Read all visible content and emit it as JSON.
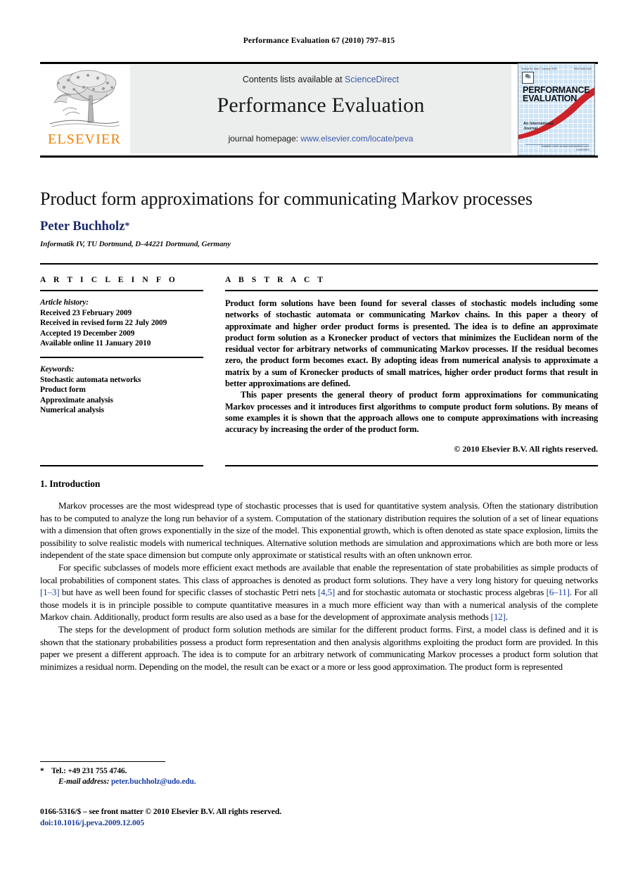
{
  "running_head": "Performance Evaluation 67 (2010) 797–815",
  "journal_header": {
    "contents_prefix": "Contents lists available at ",
    "contents_link": "ScienceDirect",
    "journal_name": "Performance Evaluation",
    "homepage_prefix": "journal homepage: ",
    "homepage_link": "www.elsevier.com/locate/peva",
    "publisher_wordmark": "ELSEVIER",
    "link_color": "#3a5ba8",
    "panel_color": "#eceded",
    "elsevier_orange": "#f08000"
  },
  "cover": {
    "top_left": "Volume 64, Issue 1  January 2009",
    "top_right": "ISSN 0166-5316",
    "title_line1": "PERFORMANCE",
    "title_line2": "EVALUATION",
    "subtitle_line1": "An International",
    "subtitle_line2": "Journal",
    "footer": "Available online at www.sciencedirect.com",
    "publisher": "ELSEVIER",
    "grid_color": "#cfe4f5",
    "swoosh_color": "#cc2229"
  },
  "article": {
    "title": "Product form approximations for communicating Markov processes",
    "author": "Peter Buchholz",
    "author_marker": "*",
    "author_color": "#1c2a6b",
    "affiliation": "Informatik IV, TU Dortmund, D–44221 Dortmund, Germany"
  },
  "article_info": {
    "tag": "A R T I C L E   I N F O",
    "history_head": "Article history:",
    "history": [
      "Received 23 February 2009",
      "Received in revised form 22 July 2009",
      "Accepted 19 December 2009",
      "Available online 11 January 2010"
    ],
    "keywords_head": "Keywords:",
    "keywords": [
      "Stochastic automata networks",
      "Product form",
      "Approximate analysis",
      "Numerical analysis"
    ]
  },
  "abstract": {
    "tag": "A B S T R A C T",
    "paragraph1": "Product form solutions have been found for several classes of stochastic models including some networks of stochastic automata or communicating Markov chains. In this paper a theory of approximate and higher order product forms is presented. The idea is to define an approximate product form solution as a Kronecker product of vectors that minimizes the Euclidean norm of the residual vector for arbitrary networks of communicating Markov processes. If the residual becomes zero, the product form becomes exact. By adopting ideas from numerical analysis to approximate a matrix by a sum of Kronecker products of small matrices, higher order product forms that result in better approximations are defined.",
    "paragraph2": "This paper presents the general theory of product form approximations for communicating Markov processes and it introduces first algorithms to compute product form solutions. By means of some examples it is shown that the approach allows one to compute approximations with increasing accuracy by increasing the order of the product form.",
    "copyright": "© 2010 Elsevier B.V. All rights reserved."
  },
  "body": {
    "section_heading": "1. Introduction",
    "para1": "Markov processes are the most widespread type of stochastic processes that is used for quantitative system analysis. Often the stationary distribution has to be computed to analyze the long run behavior of a system. Computation of the stationary distribution requires the solution of a set of linear equations with a dimension that often grows exponentially in the size of the model. This exponential growth, which is often denoted as state space explosion, limits the possibility to solve realistic models with numerical techniques. Alternative solution methods are simulation and approximations which are both more or less independent of the state space dimension but compute only approximate or statistical results with an often unknown error.",
    "para2_a": "For specific subclasses of models more efficient exact methods are available that enable the representation of state probabilities as simple products of local probabilities of component states. This class of approaches is denoted as product form solutions. They have a very long history for queuing networks ",
    "cite1": "[1–3]",
    "para2_b": " but have as well been found for specific classes of stochastic Petri nets ",
    "cite2": "[4,5]",
    "para2_c": " and for stochastic automata or stochastic process algebras ",
    "cite3": "[6–11]",
    "para2_d": ". For all those models it is in principle possible to compute quantitative measures in a much more efficient way than with a numerical analysis of the complete Markov chain. Additionally, product form results are also used as a base for the development of approximate analysis methods ",
    "cite4": "[12]",
    "para2_e": ".",
    "para3": "The steps for the development of product form solution methods are similar for the different product forms. First, a model class is defined and it is shown that the stationary probabilities possess a product form representation and then analysis algorithms exploiting the product form are provided. In this paper we present a different approach. The idea is to compute for an arbitrary network of communicating Markov processes a product form solution that minimizes a residual norm. Depending on the model, the result can be exact or a more or less good approximation. The product form is represented",
    "cite_color": "#1c3fa0"
  },
  "footer": {
    "footnote_marker": "*",
    "tel": "Tel.: +49 231 755 4746.",
    "email_label": "E-mail address:",
    "email": "peter.buchholz@udo.edu",
    "email_trail": ".",
    "imprint": "0166-5316/$ – see front matter © 2010 Elsevier B.V. All rights reserved.",
    "doi": "doi:10.1016/j.peva.2009.12.005"
  }
}
